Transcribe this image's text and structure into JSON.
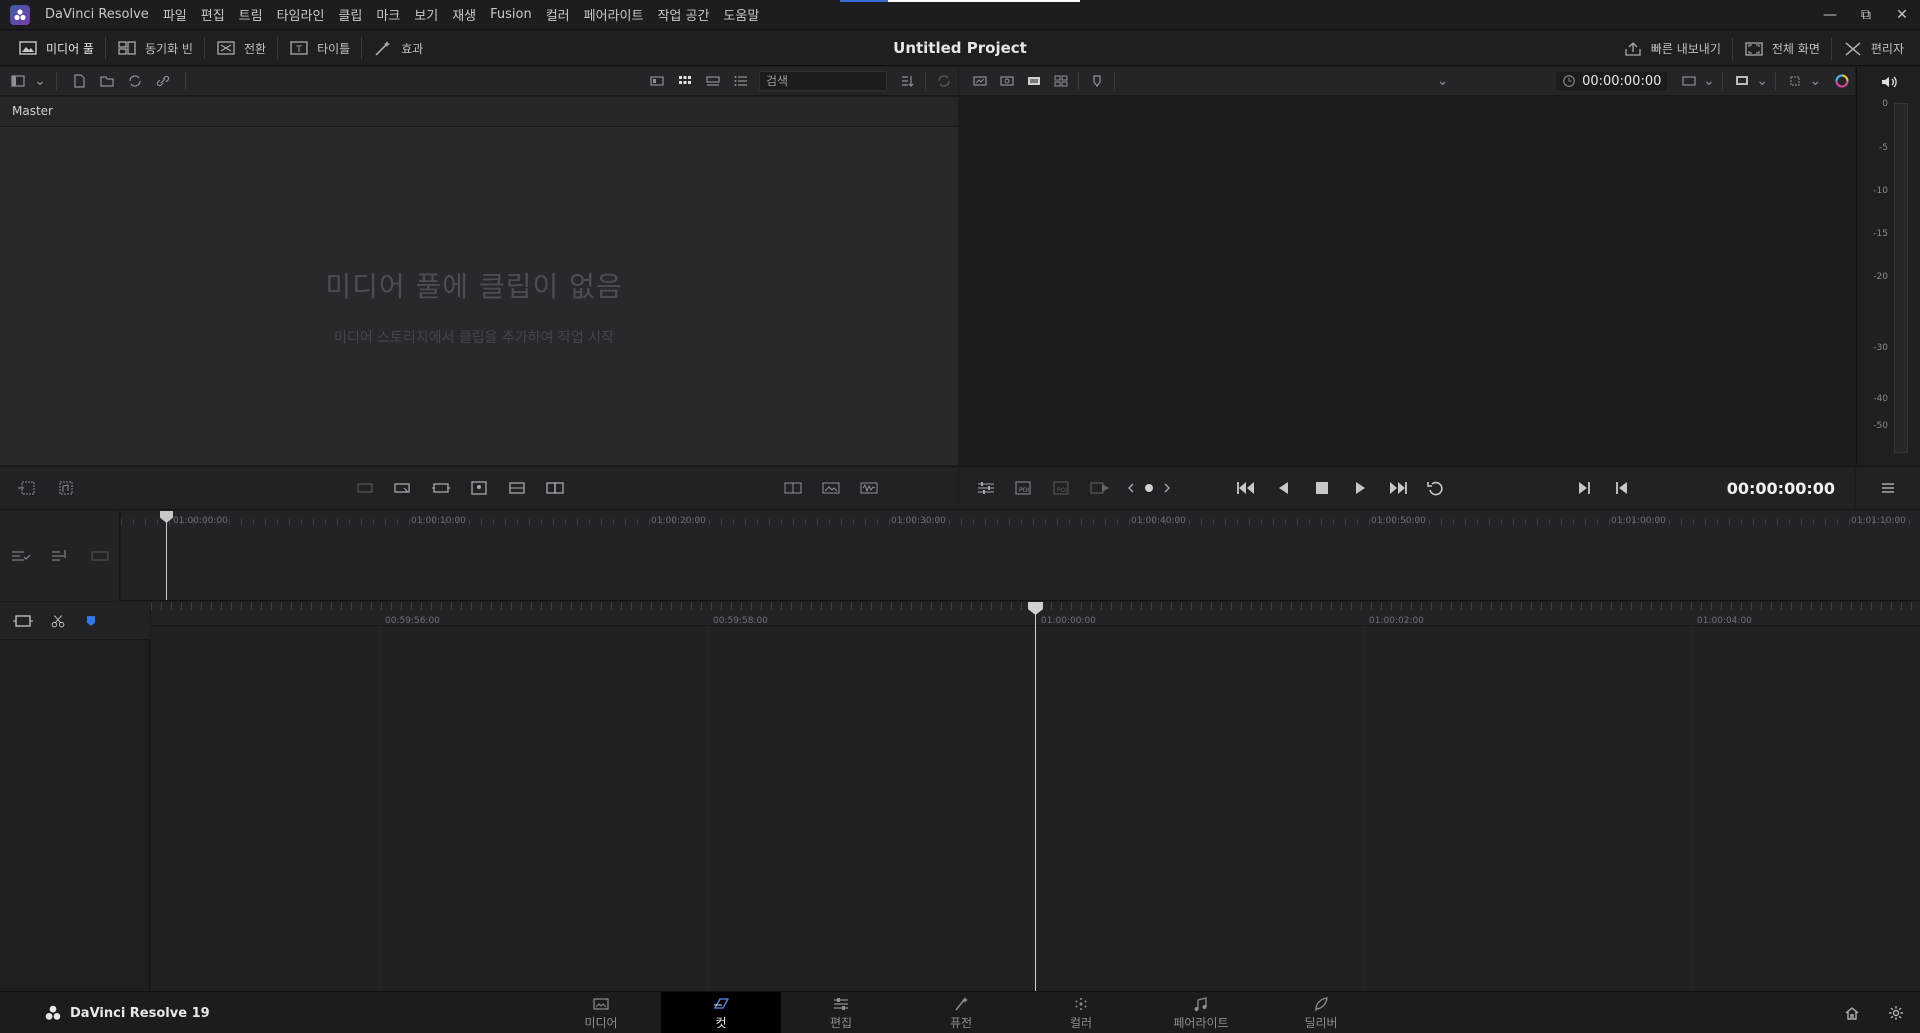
{
  "app": {
    "name": "DaVinci Resolve",
    "brand": "DaVinci Resolve 19",
    "project_title": "Untitled Project"
  },
  "menu": [
    "파일",
    "편집",
    "트림",
    "타임라인",
    "클립",
    "마크",
    "보기",
    "재생",
    "Fusion",
    "컬러",
    "페어라이트",
    "작업 공간",
    "도움말"
  ],
  "toolbar": {
    "left": [
      {
        "label": "미디어 풀",
        "icon": "media-pool-icon"
      },
      {
        "label": "동기화 빈",
        "icon": "sync-bin-icon"
      },
      {
        "label": "전환",
        "icon": "transitions-icon"
      },
      {
        "label": "타이틀",
        "icon": "titles-icon"
      },
      {
        "label": "효과",
        "icon": "effects-icon"
      }
    ],
    "right": [
      {
        "label": "빠른 내보내기",
        "icon": "quick-export-icon"
      },
      {
        "label": "전체 화면",
        "icon": "fullscreen-icon"
      },
      {
        "label": "편리자",
        "icon": "tools-icon"
      }
    ]
  },
  "media_pool": {
    "search_placeholder": "검색",
    "bin_name": "Master",
    "empty_title": "미디어 풀에 클립이 없음",
    "empty_subtitle": "미디어 스토리지에서 클립을 추가하여 작업 시작"
  },
  "viewer": {
    "timecode_top": "00:00:00:00",
    "timecode_main": "00:00:00:00"
  },
  "audio_meter": {
    "ticks": [
      "0",
      "-5",
      "-10",
      "-15",
      "-20",
      "-30",
      "-40",
      "-50"
    ]
  },
  "upper_timeline": {
    "labels": [
      "01:00:00:00",
      "01:00:10:00",
      "01:00:20:00",
      "01:00:30:00",
      "01:00:40:00",
      "01:00:50:00",
      "01:01:00:00",
      "01:01:10:00"
    ]
  },
  "lower_timeline": {
    "labels": [
      "00:59:56:00",
      "00:59:58:00",
      "01:00:00:00",
      "01:00:02:00",
      "01:00:04:00"
    ]
  },
  "pages": [
    {
      "label": "미디어",
      "icon": "media-page-icon",
      "active": false
    },
    {
      "label": "컷",
      "icon": "cut-page-icon",
      "active": true
    },
    {
      "label": "편집",
      "icon": "edit-page-icon",
      "active": false
    },
    {
      "label": "퓨전",
      "icon": "fusion-page-icon",
      "active": false
    },
    {
      "label": "컬러",
      "icon": "color-page-icon",
      "active": false
    },
    {
      "label": "페어라이트",
      "icon": "fairlight-page-icon",
      "active": false
    },
    {
      "label": "딜리버",
      "icon": "deliver-page-icon",
      "active": false
    }
  ],
  "colors": {
    "background": "#1c1c1f",
    "accent": "#3a6fd8",
    "flag_blue": "#2f7be5"
  }
}
